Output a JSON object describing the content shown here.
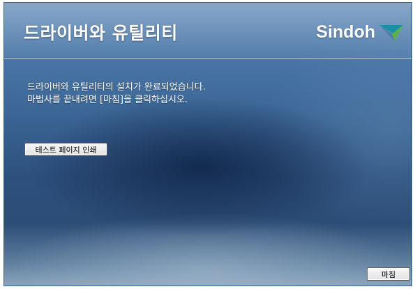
{
  "window": {
    "title": "드라이버와 유틸리티",
    "brand": "Sindoh",
    "brand_colors": {
      "teal": "#1a8fa6",
      "green": "#5cb24a"
    }
  },
  "main": {
    "message_line1": "드라이버와 유틸리티의 설치가 완료되었습니다.",
    "message_line2": "마법사를 끝내려면 [마침]을 클릭하십시오.",
    "print_test_label": "테스트 페이지 인쇄"
  },
  "footer": {
    "finish_label": "마침"
  }
}
